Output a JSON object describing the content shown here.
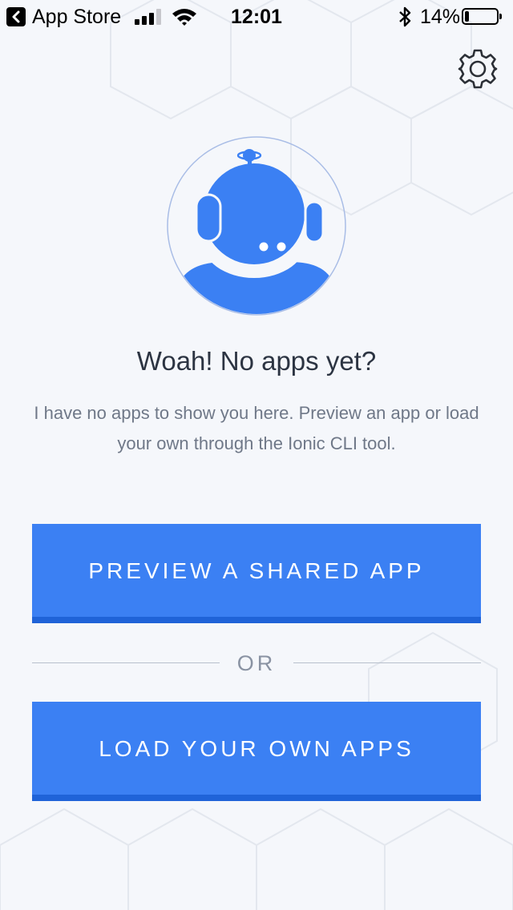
{
  "status_bar": {
    "back_app": "App Store",
    "time": "12:01",
    "battery_text": "14%",
    "battery_level": 0.14,
    "signal_bars": 3
  },
  "toolbar": {
    "settings_icon": "gear-icon"
  },
  "empty_state": {
    "avatar_icon": "robot-astronaut-icon",
    "title": "Woah! No apps yet?",
    "description": "I have no apps to show you here. Preview an app or load your own through the Ionic CLI tool."
  },
  "actions": {
    "preview_label": "PREVIEW A SHARED APP",
    "divider_label": "OR",
    "load_label": "LOAD YOUR OWN APPS"
  },
  "colors": {
    "accent": "#3b80f3",
    "accent_dark": "#1f63d8",
    "background": "#f5f7fb",
    "title": "#2c3442",
    "text_muted": "#6f7888"
  }
}
